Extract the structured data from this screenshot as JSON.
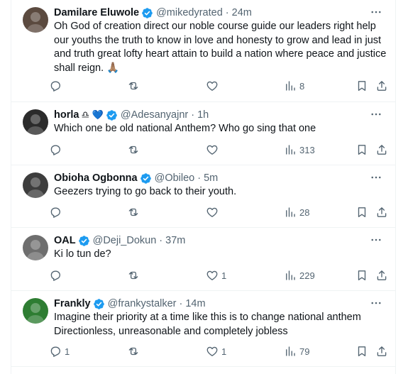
{
  "tweets": [
    {
      "name": "Damilare Eluwole",
      "verified": true,
      "emojis": "",
      "handle": "@mikedyrated",
      "time": "24m",
      "text": "Oh God of creation direct our noble course guide our leaders right help our youths the truth to know in love and honesty to grow and lead in just and truth great lofty heart attain to build a nation where peace and justice shall reign. 🙏🏽",
      "replies": "",
      "retweets": "",
      "likes": "",
      "views": "8",
      "avatar_color": "#5b4a3f"
    },
    {
      "name": "horla",
      "verified": true,
      "emojis": "♎ 💙",
      "handle": "@Adesanyajnr",
      "time": "1h",
      "text": "Which one be old national Anthem? Who go sing that one",
      "replies": "",
      "retweets": "",
      "likes": "",
      "views": "313",
      "avatar_color": "#2b2b2b"
    },
    {
      "name": "Obioha Ogbonna",
      "verified": true,
      "emojis": "",
      "handle": "@Obileo",
      "time": "5m",
      "text": "Geezers trying to go back to their youth.",
      "replies": "",
      "retweets": "",
      "likes": "",
      "views": "28",
      "avatar_color": "#3d3d3d"
    },
    {
      "name": "OAL",
      "verified": true,
      "emojis": "",
      "handle": "@Deji_Dokun",
      "time": "37m",
      "text": "Ki lo tun de?",
      "replies": "",
      "retweets": "",
      "likes": "1",
      "views": "229",
      "avatar_color": "#6e6e6e"
    },
    {
      "name": "Frankly",
      "verified": true,
      "emojis": "",
      "handle": "@frankystalker",
      "time": "14m",
      "text": "Imagine their priority at a time like this is to change national anthem Directionless, unreasonable and completely jobless",
      "replies": "1",
      "retweets": "",
      "likes": "1",
      "views": "79",
      "avatar_color": "#2e7d32"
    }
  ],
  "colors": {
    "verified_blue": "#1d9bf0",
    "secondary_text": "#536471",
    "divider": "#eff3f4"
  },
  "icons": [
    "more-icon",
    "reply-icon",
    "retweet-icon",
    "like-icon",
    "views-icon",
    "bookmark-icon",
    "share-icon"
  ]
}
